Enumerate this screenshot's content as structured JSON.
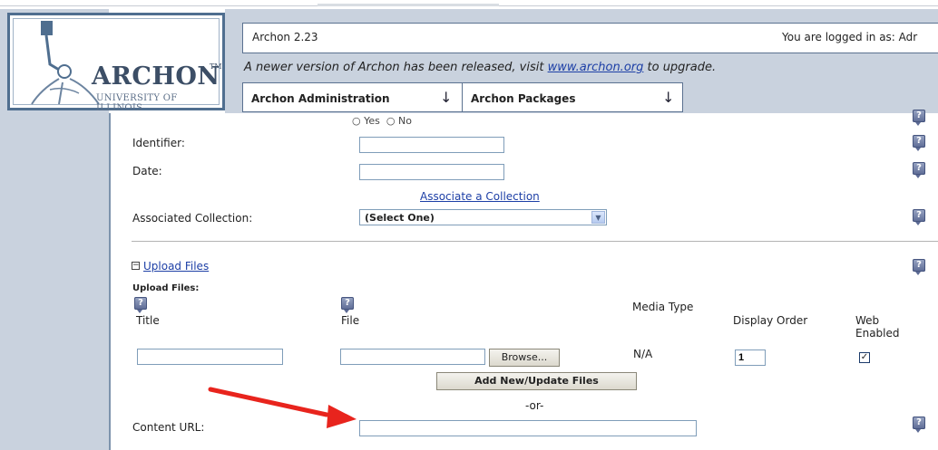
{
  "header": {
    "app_version": "Archon 2.23",
    "login_status": "You are logged in as: Adr",
    "notice_before": "A newer version of Archon has been released, visit ",
    "notice_link": "www.archon.org",
    "notice_after": " to upgrade.",
    "tabs": [
      {
        "label": "Archon Administration",
        "arrow": "↓"
      },
      {
        "label": "Archon Packages",
        "arrow": "↓"
      }
    ]
  },
  "logo": {
    "name": "ARCHON",
    "tm": "TM",
    "subtitle": "UNIVERSITY OF ILLINOIS"
  },
  "form": {
    "radio_yes": "Yes",
    "radio_no": "No",
    "identifier_label": "Identifier:",
    "identifier_value": "",
    "date_label": "Date:",
    "date_value": "",
    "associate_link": "Associate a Collection",
    "associated_collection_label": "Associated Collection:",
    "associated_collection_value": "(Select One)",
    "upload_section_link": "Upload Files",
    "upload_files_label": "Upload Files:",
    "col_title": "Title",
    "col_file": "File",
    "col_media_type": "Media Type",
    "col_display_order": "Display Order",
    "col_web_enabled_1": "Web",
    "col_web_enabled_2": "Enabled",
    "title_value": "",
    "file_value": "",
    "browse_label": "Browse...",
    "media_type_value": "N/A",
    "display_order_value": "1",
    "web_enabled_checked": true,
    "add_update_button": "Add New/Update Files",
    "or_label": "-or-",
    "content_url_label": "Content URL:",
    "content_url_value": "",
    "help_glyph": "?"
  },
  "colors": {
    "sidebar": "#c9d2de",
    "border": "#5a7190",
    "link": "#1d3fa6",
    "annotation_arrow": "#e8241d"
  }
}
